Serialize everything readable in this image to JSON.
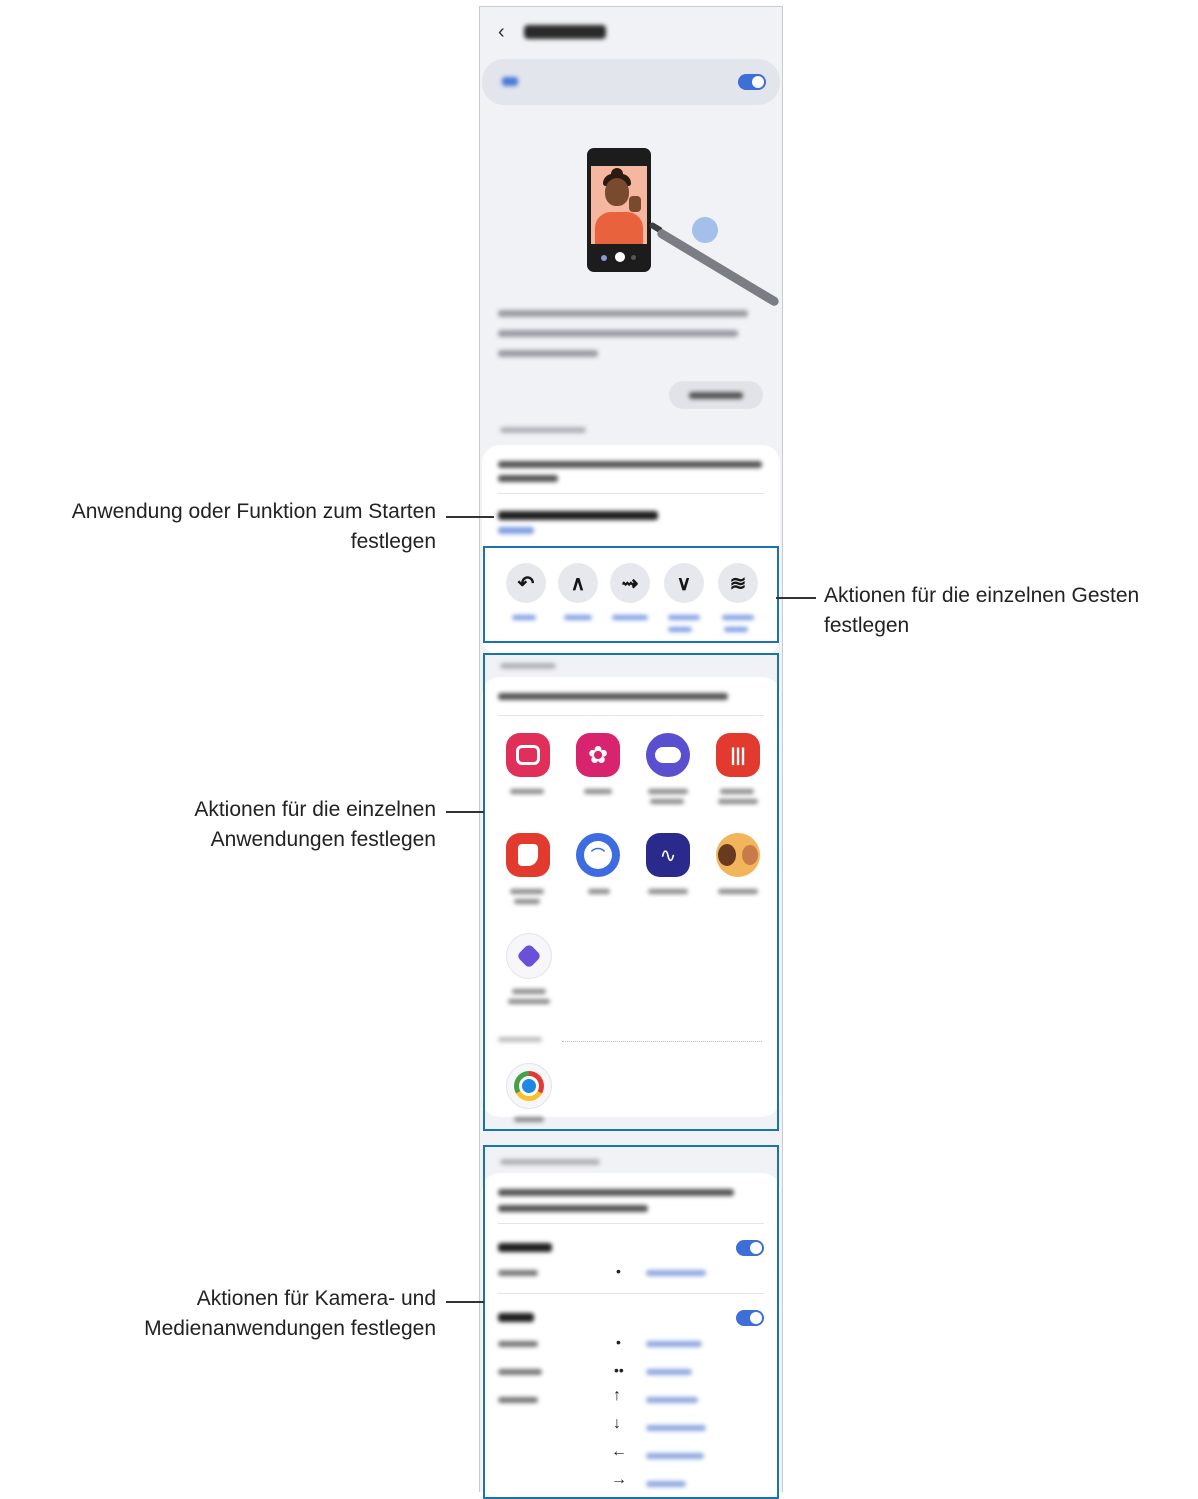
{
  "annotations": {
    "starten_line1": "Anwendung oder Funktion zum Starten",
    "starten_line2": "festlegen",
    "gesten_line1": "Aktionen für die einzelnen Gesten",
    "gesten_line2": "festlegen",
    "anwendungen_line1": "Aktionen für die einzelnen",
    "anwendungen_line2": "Anwendungen festlegen",
    "kamera_line1": "Aktionen für Kamera- und",
    "kamera_line2": "Medienanwendungen festlegen"
  },
  "phone": {
    "on_toggle": true,
    "camera_toggle": true,
    "media_toggle": true,
    "gesture_icons": [
      "↶",
      "∧",
      "⇝",
      "∨",
      "≋"
    ],
    "media_symbols": [
      "•",
      "••",
      "↑",
      "↓",
      "←",
      "→",
      "•"
    ]
  },
  "colors": {
    "accent": "#1a74ac",
    "toggle": "#3e6ed6",
    "link": "#8fa8e0"
  }
}
